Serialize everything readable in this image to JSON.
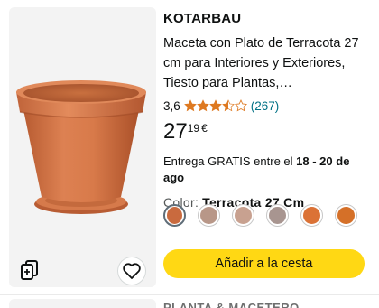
{
  "product": {
    "brand": "KOTARBAU",
    "title": "Maceta con Plato de Terracota 27 cm para Interiores y Exteriores, Tiesto para Plantas,…",
    "image_icon": "terracotta-pot-image",
    "rating": {
      "value": "3,6",
      "stars": 3.5,
      "count": "(267)"
    },
    "price": {
      "whole": "27",
      "fraction": "19",
      "currency": "€"
    },
    "delivery": {
      "prefix": "Entrega GRATIS entre el ",
      "dates": "18 - 20 de ago"
    },
    "color": {
      "label": "Color:",
      "value": "Terracota 27 Cm"
    },
    "swatches": [
      {
        "color": "#c96a3e",
        "selected": true
      },
      {
        "color": "#b89788",
        "selected": false
      },
      {
        "color": "#c8a190",
        "selected": false
      },
      {
        "color": "#a89590",
        "selected": false
      },
      {
        "color": "#db7236",
        "selected": false
      },
      {
        "color": "#d57028",
        "selected": false
      }
    ],
    "add_to_cart_label": "Añadir a la cesta",
    "compare_icon": "compare-icon",
    "wishlist_icon": "heart-icon"
  },
  "next_product": {
    "brand": "PLANTA & MACETERO"
  },
  "colors": {
    "star": "#de7921",
    "link": "#007185",
    "cart_button": "#ffd814",
    "image_bg": "#f3f3f3"
  }
}
